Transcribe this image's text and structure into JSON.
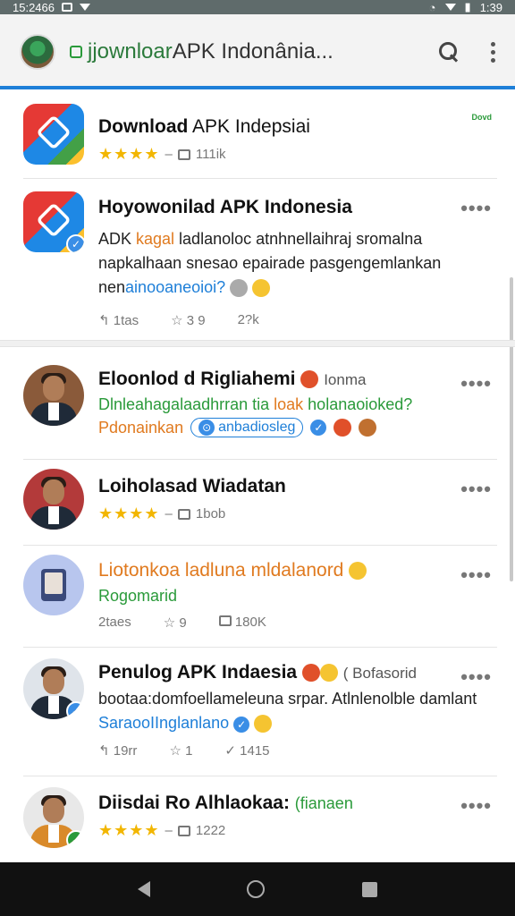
{
  "status": {
    "time": "15:2466",
    "right": "1:39"
  },
  "appbar": {
    "title_prefix": "jjownloar",
    "title_rest": " APK Indonânia..."
  },
  "items": [
    {
      "title": "Download",
      "title_thin": " APK Indepsiai",
      "stars": "★★★★",
      "dash": "–",
      "count": "111ik",
      "tag": "Dovd"
    },
    {
      "title": "Hoyowonilad APK Indonesia",
      "more": "••••",
      "body_pre": "ADK ",
      "body_hl": "kagal",
      "body_mid": " ladlanoloc atnhnellaihraj sromalna napkalhaan snesao epairade pasgengemlankan nen",
      "body_blue": "ainooaneoioi?",
      "stat1": "1tas",
      "stat2": "3 9",
      "stat3": "2?k"
    },
    {
      "title": "Eloonlod d Rigliahemi",
      "title_soft": "Ionma",
      "more": "••••",
      "green": "Dlnleahagalaadhrran tia ",
      "green_hl": "loak",
      "green_rest": " holanaoioked?",
      "orange": "Pdonainkan",
      "chip": "anbadiosleg"
    },
    {
      "title": "Loiholasad Wiadatan",
      "stars": "★★★★",
      "dash": "–",
      "count": "1bob",
      "more": "••••"
    },
    {
      "title": "Liotonkoa ladluna mldalanord",
      "more": "••••",
      "green": "Rogomarid",
      "stat1": "2taes",
      "stat2": "9",
      "stat3": "180K"
    },
    {
      "title": "Penulog APK Indaesia",
      "title_soft": "( Bofasorid",
      "more": "••••",
      "body_mid": "bootaa:domfoellameleuna srpar. Atlnlenolble damlant ",
      "body_blue": "SaraooIInglanlano",
      "stat1": "19rr",
      "stat2": "1",
      "stat3": "1415"
    },
    {
      "title": "Diisdai Ro Alhlaokaa:",
      "title_green": "(fianaen",
      "stars": "★★★★",
      "dash": "–",
      "count": "1222",
      "more": "••••"
    }
  ]
}
